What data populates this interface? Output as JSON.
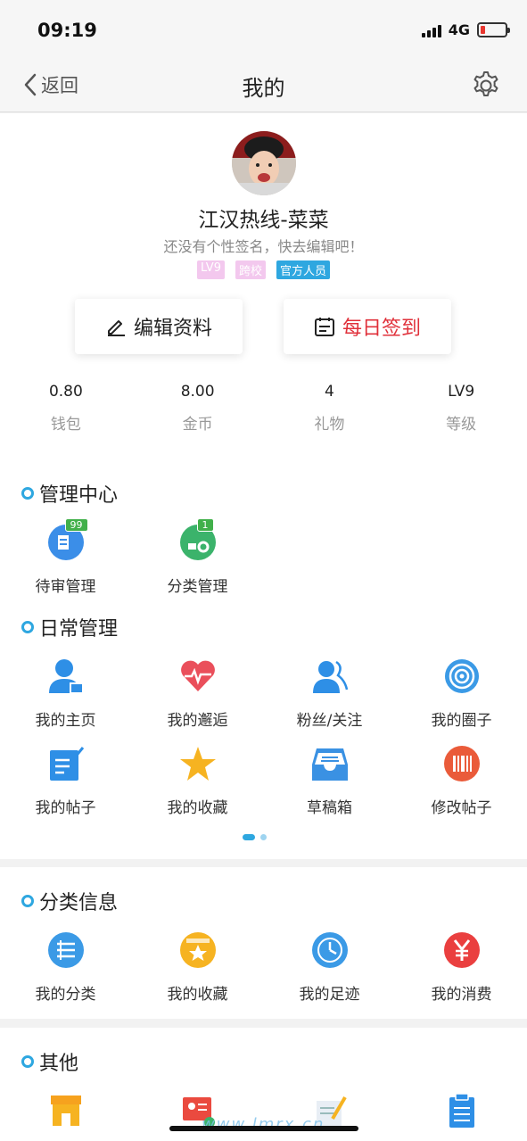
{
  "status_bar": {
    "time": "09:19",
    "network": "4G"
  },
  "nav": {
    "back_label": "返回",
    "title": "我的",
    "settings_icon": "gear-icon"
  },
  "profile": {
    "name": "江汉热线-菜菜",
    "signature": "还没有个性签名，快去编辑吧！",
    "badges": [
      "LV9",
      "跨校",
      "官方人员"
    ],
    "edit_label": "编辑资料",
    "checkin_label": "每日签到",
    "stats": [
      {
        "value": "0.80",
        "label": "钱包"
      },
      {
        "value": "8.00",
        "label": "金币"
      },
      {
        "value": "4",
        "label": "礼物"
      },
      {
        "value": "LV9",
        "label": "等级"
      }
    ]
  },
  "management": {
    "title": "管理中心",
    "items": [
      {
        "label": "待审管理",
        "icon": "review-icon",
        "count": "99"
      },
      {
        "label": "分类管理",
        "icon": "category-settings-icon",
        "count": "1"
      }
    ]
  },
  "daily": {
    "title": "日常管理",
    "items": [
      {
        "label": "我的主页",
        "icon": "user-home-icon"
      },
      {
        "label": "我的邂逅",
        "icon": "heartbeat-icon"
      },
      {
        "label": "粉丝/关注",
        "icon": "followers-icon"
      },
      {
        "label": "我的圈子",
        "icon": "circle-icon"
      },
      {
        "label": "我的帖子",
        "icon": "post-edit-icon"
      },
      {
        "label": "我的收藏",
        "icon": "star-icon"
      },
      {
        "label": "草稿箱",
        "icon": "inbox-icon"
      },
      {
        "label": "修改帖子",
        "icon": "barcode-icon"
      }
    ]
  },
  "classify": {
    "title": "分类信息",
    "items": [
      {
        "label": "我的分类",
        "icon": "list-icon"
      },
      {
        "label": "我的收藏",
        "icon": "favorite-folder-icon"
      },
      {
        "label": "我的足迹",
        "icon": "clock-icon"
      },
      {
        "label": "我的消费",
        "icon": "yuan-icon"
      }
    ]
  },
  "others": {
    "title": "其他",
    "items": [
      {
        "icon": "shop-icon"
      },
      {
        "icon": "id-card-icon"
      },
      {
        "icon": "sign-document-icon"
      },
      {
        "icon": "clipboard-icon"
      }
    ]
  },
  "watermark": "www.lmrx.cn",
  "colors": {
    "accent": "#2ea7e0",
    "checkin": "#e0313b"
  }
}
